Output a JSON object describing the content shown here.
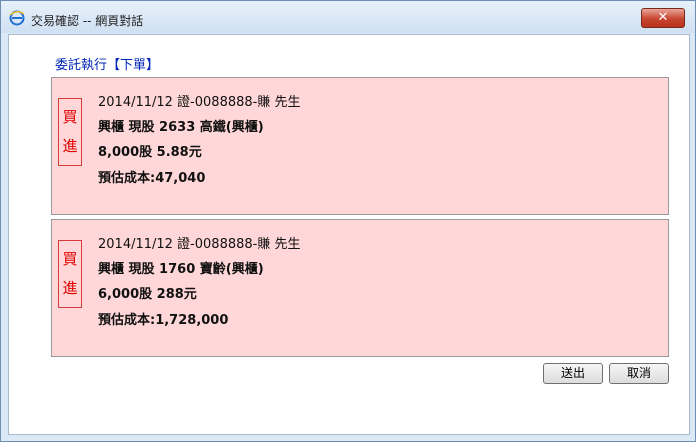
{
  "window": {
    "title": "交易確認 -- 網頁對話",
    "close_label": "✕"
  },
  "heading": "委託執行【下單】",
  "orders": [
    {
      "side_chars": [
        "買",
        "進"
      ],
      "header": "2014/11/12 證-0088888-賺 先生",
      "detail": "興櫃 現股 2633 高鐵(興櫃)",
      "qty_price": "8,000股 5.88元",
      "est_cost": "預估成本:47,040"
    },
    {
      "side_chars": [
        "買",
        "進"
      ],
      "header": "2014/11/12 證-0088888-賺 先生",
      "detail": "興櫃 現股 1760 寶齡(興櫃)",
      "qty_price": "6,000股 288元",
      "est_cost": "預估成本:1,728,000"
    }
  ],
  "buttons": {
    "send": "送出",
    "cancel": "取消"
  }
}
